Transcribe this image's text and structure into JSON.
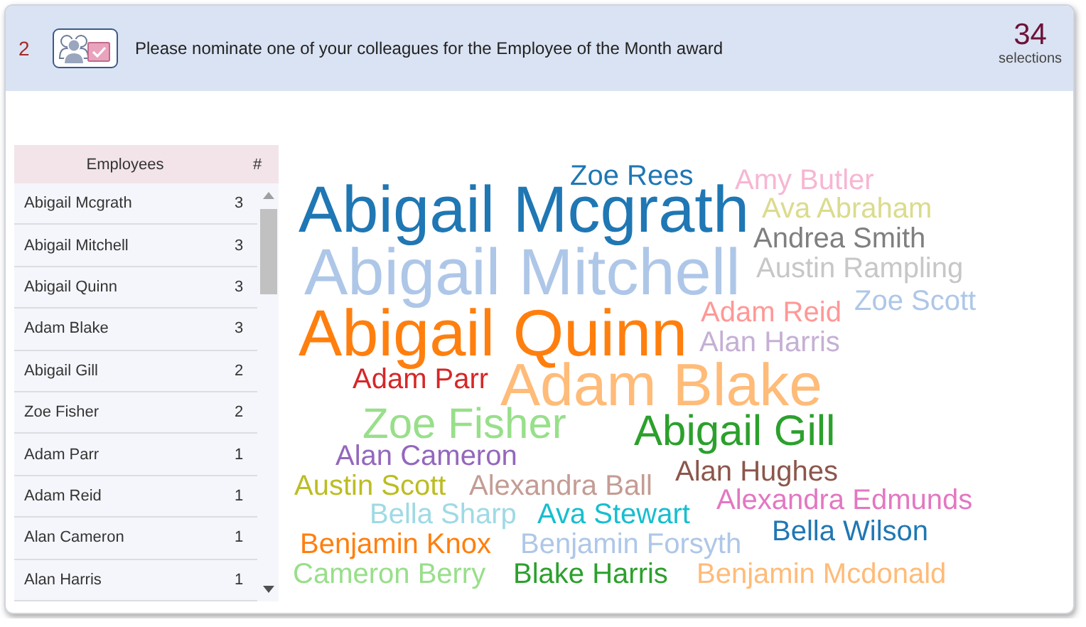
{
  "question": {
    "number": "2",
    "text": "Please nominate one of your colleagues for the Employee of the Month award",
    "count": "34",
    "count_label": "selections"
  },
  "table": {
    "columns": [
      "Employees",
      "#"
    ],
    "rows": [
      {
        "name": "Abigail Mcgrath",
        "count": "3"
      },
      {
        "name": "Abigail Mitchell",
        "count": "3"
      },
      {
        "name": "Abigail Quinn",
        "count": "3"
      },
      {
        "name": "Adam Blake",
        "count": "3"
      },
      {
        "name": "Abigail Gill",
        "count": "2"
      },
      {
        "name": "Zoe Fisher",
        "count": "2"
      },
      {
        "name": "Adam Parr",
        "count": "1"
      },
      {
        "name": "Adam Reid",
        "count": "1"
      },
      {
        "name": "Alan Cameron",
        "count": "1"
      },
      {
        "name": "Alan Harris",
        "count": "1"
      }
    ]
  },
  "word_cloud": {
    "words": [
      {
        "text": "Zoe Rees",
        "color": "#1f77b4"
      },
      {
        "text": "Amy Butler",
        "color": "#f7b6d2"
      },
      {
        "text": "Abigail Mcgrath",
        "color": "#1f77b4"
      },
      {
        "text": "Ava Abraham",
        "color": "#dbdb8d"
      },
      {
        "text": "Andrea Smith",
        "color": "#7f7f7f"
      },
      {
        "text": "Abigail Mitchell",
        "color": "#aec7e8"
      },
      {
        "text": "Austin Rampling",
        "color": "#c7c7c7"
      },
      {
        "text": "Zoe Scott",
        "color": "#aec7e8"
      },
      {
        "text": "Abigail Quinn",
        "color": "#ff7f0e"
      },
      {
        "text": "Adam Reid",
        "color": "#ff9896"
      },
      {
        "text": "Alan Harris",
        "color": "#c5b0d5"
      },
      {
        "text": "Adam Parr",
        "color": "#d62728"
      },
      {
        "text": "Adam Blake",
        "color": "#ffbb78"
      },
      {
        "text": "Zoe Fisher",
        "color": "#98df8a"
      },
      {
        "text": "Abigail Gill",
        "color": "#2ca02c"
      },
      {
        "text": "Alan Cameron",
        "color": "#9467bd"
      },
      {
        "text": "Austin Scott",
        "color": "#bcbd22"
      },
      {
        "text": "Alexandra Ball",
        "color": "#c49c94"
      },
      {
        "text": "Alan Hughes",
        "color": "#8c564b"
      },
      {
        "text": "Alexandra Edmunds",
        "color": "#e377c2"
      },
      {
        "text": "Bella Sharp",
        "color": "#9edae5"
      },
      {
        "text": "Ava Stewart",
        "color": "#17becf"
      },
      {
        "text": "Bella Wilson",
        "color": "#1f77b4"
      },
      {
        "text": "Benjamin Knox",
        "color": "#ff7f0e"
      },
      {
        "text": "Benjamin Forsyth",
        "color": "#aec7e8"
      },
      {
        "text": "Cameron Berry",
        "color": "#98df8a"
      },
      {
        "text": "Blake Harris",
        "color": "#2ca02c"
      },
      {
        "text": "Benjamin Mcdonald",
        "color": "#ffbb78"
      }
    ]
  }
}
